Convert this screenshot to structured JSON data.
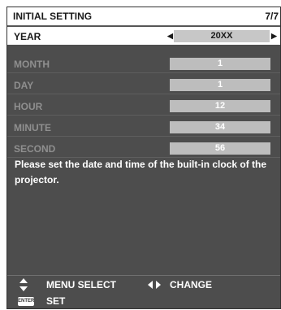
{
  "window": {
    "title": "INITIAL SETTING",
    "page": "7/7"
  },
  "settings": [
    {
      "label": "YEAR",
      "value": "20XX"
    },
    {
      "label": "MONTH",
      "value": "1"
    },
    {
      "label": "DAY",
      "value": "1"
    },
    {
      "label": "HOUR",
      "value": "12"
    },
    {
      "label": "MINUTE",
      "value": "34"
    },
    {
      "label": "SECOND",
      "value": "56"
    }
  ],
  "description": "Please set the date and time of the built-in clock of the projector.",
  "help": {
    "menu_select_label": "MENU SELECT",
    "change_label": "CHANGE",
    "enter_icon_text": "ENTER",
    "set_label": "SET"
  },
  "colors": {
    "background": "#4d4d4d",
    "highlight_row": "#ffffff",
    "value_box": "#bdbdbd",
    "dim_label": "#8f8f8f"
  },
  "icons": [
    "arrow-left-icon",
    "arrow-right-icon",
    "up-down-icon",
    "left-right-icon",
    "enter-icon"
  ]
}
